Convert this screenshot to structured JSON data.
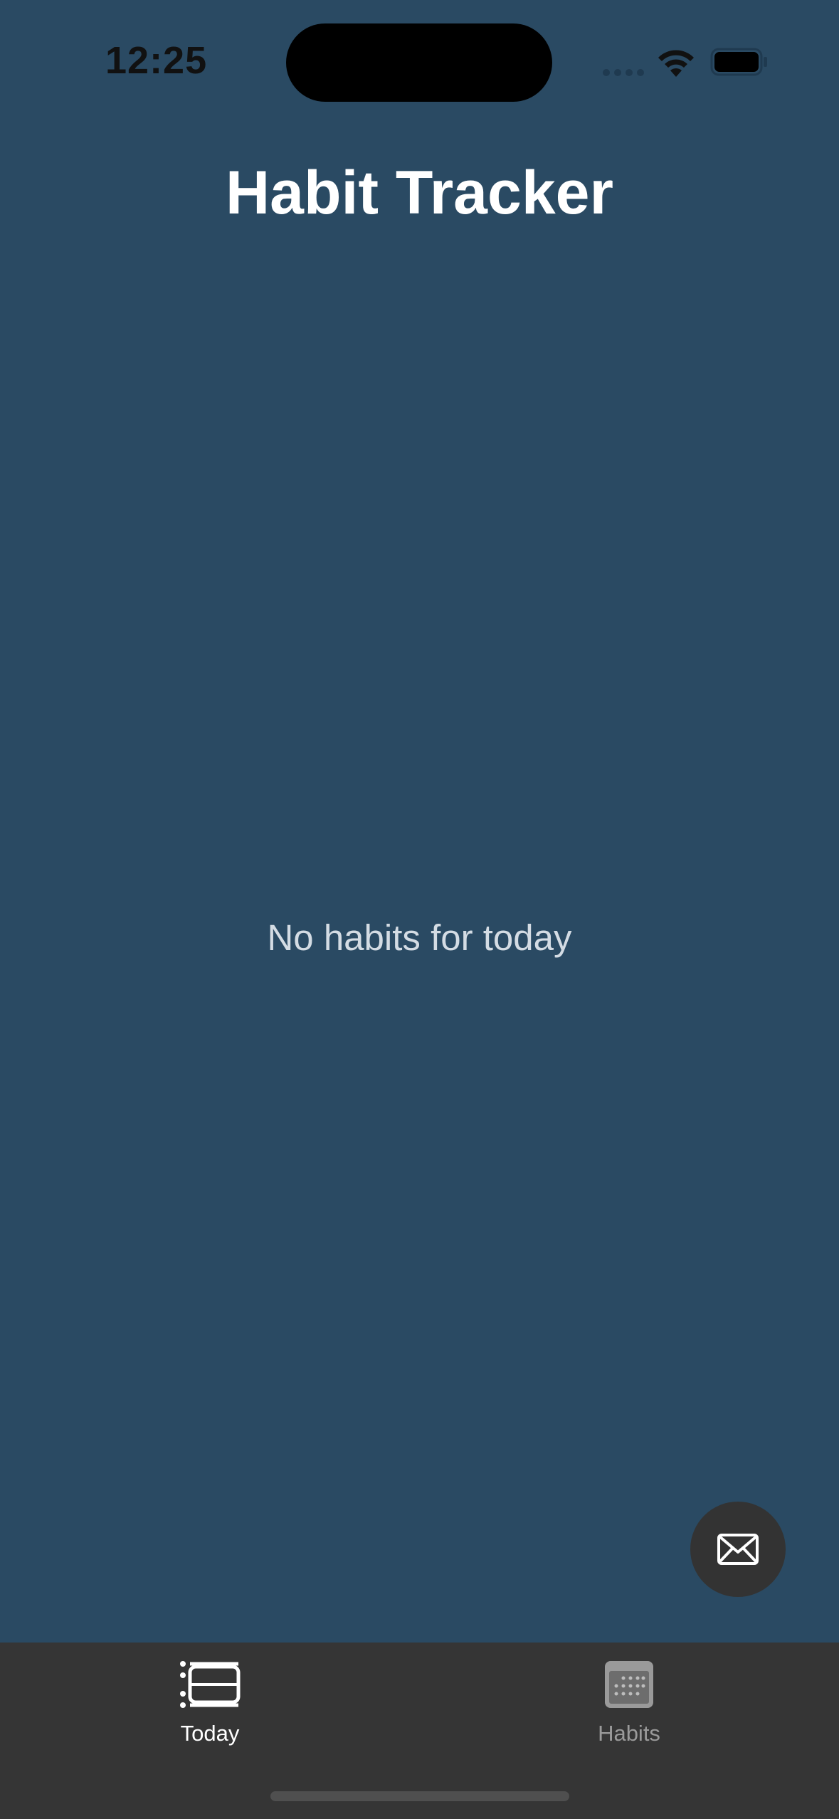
{
  "status_bar": {
    "time": "12:25",
    "text_color": "#111111"
  },
  "header": {
    "title": "Habit Tracker"
  },
  "main": {
    "empty_message": "No habits for today"
  },
  "fab": {
    "icon": "envelope-icon"
  },
  "tab_bar": {
    "tabs": [
      {
        "label": "Today",
        "icon": "today-list-icon",
        "selected": true
      },
      {
        "label": "Habits",
        "icon": "calendar-icon",
        "selected": false
      }
    ]
  },
  "colors": {
    "background": "#2a4a63",
    "tab_bar": "#353535",
    "fab": "#333333",
    "active_tab": "#ffffff",
    "inactive_tab": "#9a9a9a"
  }
}
